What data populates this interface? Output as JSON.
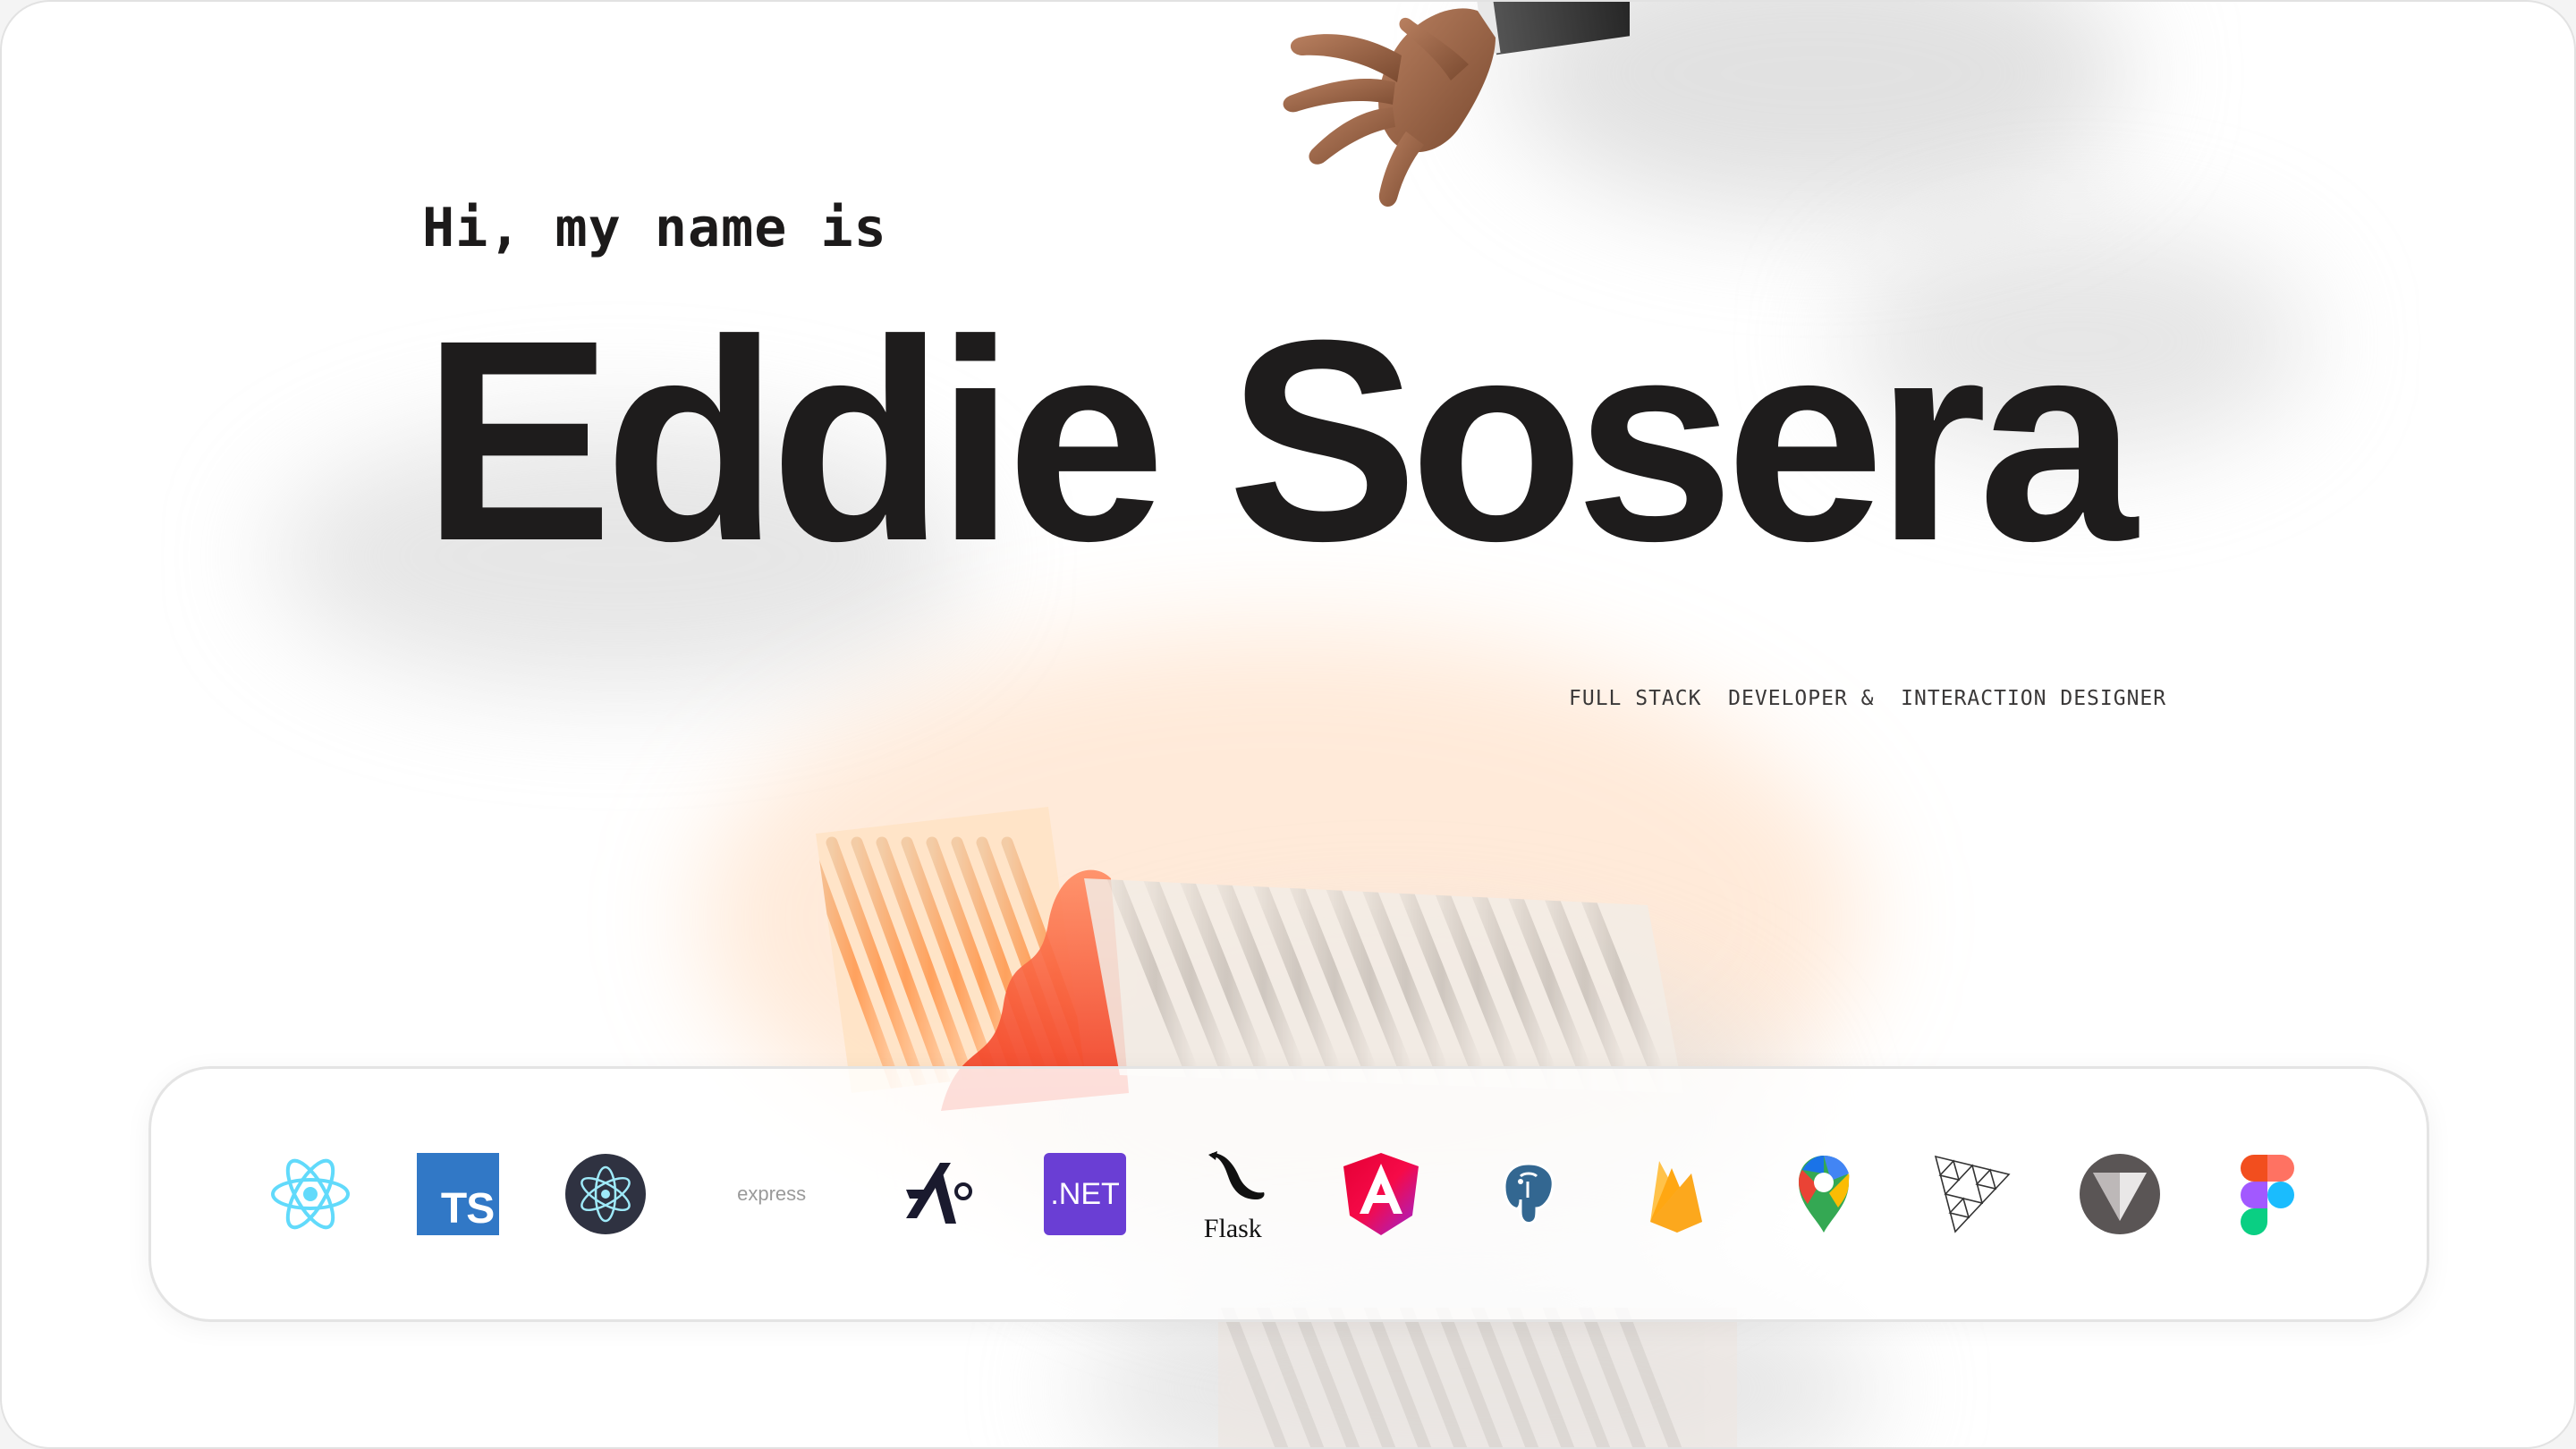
{
  "hero": {
    "greeting": "Hi, my name is",
    "name": "Eddie Sosera",
    "tagline": "FULL STACK  DEVELOPER &  INTERACTION DESIGNER"
  },
  "tech_stack": {
    "items": [
      {
        "name": "React",
        "icon": "react-icon"
      },
      {
        "name": "TypeScript",
        "icon": "typescript-icon",
        "label": "TS"
      },
      {
        "name": "Electron",
        "icon": "electron-icon"
      },
      {
        "name": "Express",
        "icon": "express-icon",
        "label": "express"
      },
      {
        "name": "Blitz",
        "icon": "blitz-icon"
      },
      {
        "name": ".NET",
        "icon": "dotnet-icon",
        "label": ".NET"
      },
      {
        "name": "Flask",
        "icon": "flask-icon",
        "label": "Flask"
      },
      {
        "name": "Angular",
        "icon": "angular-icon"
      },
      {
        "name": "PostgreSQL",
        "icon": "postgresql-icon"
      },
      {
        "name": "Firebase",
        "icon": "firebase-icon"
      },
      {
        "name": "Google Maps",
        "icon": "google-maps-icon"
      },
      {
        "name": "Three.js",
        "icon": "threejs-icon"
      },
      {
        "name": "Vite",
        "icon": "v-icon"
      },
      {
        "name": "Figma",
        "icon": "figma-icon"
      }
    ]
  },
  "colors": {
    "text": "#1e1c1c",
    "react": "#61dafb",
    "typescript": "#3178c6",
    "dotnet": "#6a3ed4",
    "angular": "#dd0031",
    "firebase": "#ffa000"
  }
}
